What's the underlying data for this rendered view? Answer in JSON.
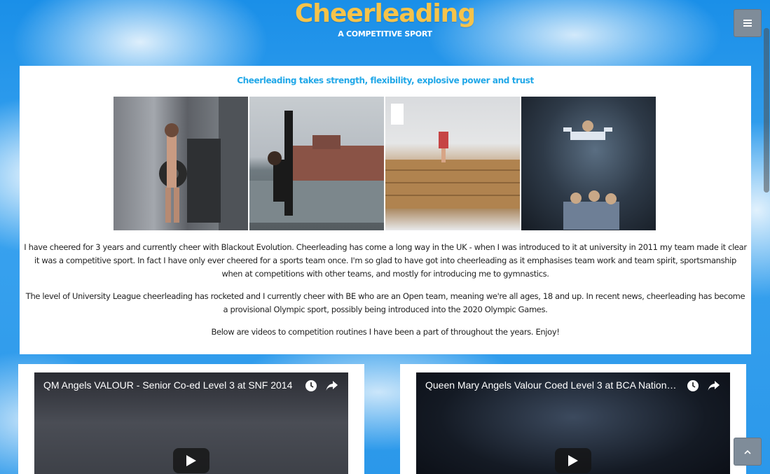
{
  "header": {
    "title": "Cheerleading",
    "subtitle": "A COMPETITIVE SPORT"
  },
  "main": {
    "tagline": "Cheerleading takes strength, flexibility, explosive power and trust",
    "photos": [
      "photo-weightlifting",
      "photo-stretch",
      "photo-flip",
      "photo-stunt"
    ],
    "paragraphs": [
      "I have cheered for 3 years and currently cheer with Blackout Evolution. Cheerleading has come a long way in the UK - when I was introduced to it at university in 2011 my team made it clear it was a competitive sport. In fact I have only ever cheered for a sports team once. I'm so glad to have got into cheerleading as it emphasises team work and team spirit, sportsmanship when at competitions with other teams, and mostly for introducing me to gymnastics.",
      "The level of University League cheerleading has rocketed and I currently cheer with BE who are an Open team, meaning we're all ages, 18 and up. In recent news, cheerleading has become a provisional Olympic sport, possibly being introduced into the 2020 Olympic Games.",
      "Below are videos to competition routines I have been a part of throughout the years. Enjoy!"
    ]
  },
  "videos": [
    {
      "title": "QM Angels VALOUR - Senior Co-ed Level 3 at SNF 2014"
    },
    {
      "title": "Queen Mary Angels Valour Coed Level 3 at BCA Nationa..."
    }
  ],
  "icons": {
    "menu": "hamburger-icon",
    "back_to_top": "chevron-up-icon",
    "watch_later": "clock-icon",
    "share": "share-icon",
    "play": "play-icon"
  },
  "colors": {
    "title": "#f6c34a",
    "tagline": "#22a8e8",
    "button": "#7f8c99"
  }
}
